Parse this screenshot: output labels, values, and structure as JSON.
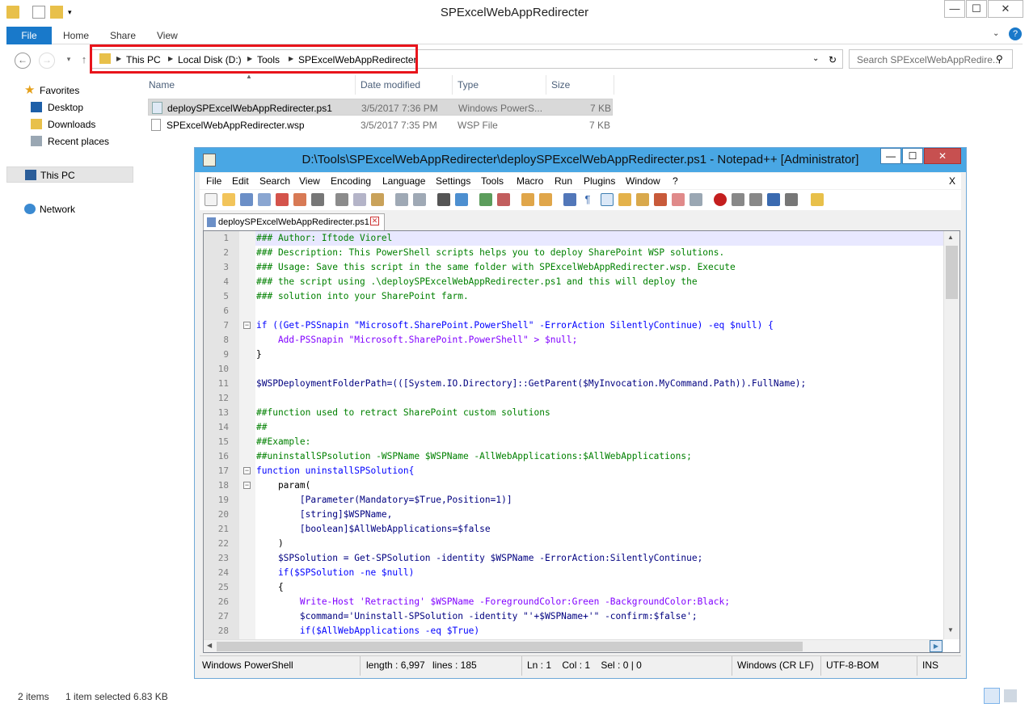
{
  "explorer": {
    "title": "SPExcelWebAppRedirecter",
    "window_controls": {
      "minimize": "—",
      "maximize": "☐",
      "close": "✕"
    },
    "ribbon": {
      "file": "File",
      "tabs": [
        "Home",
        "Share",
        "View"
      ]
    },
    "breadcrumb": [
      "This PC",
      "Local Disk (D:)",
      "Tools",
      "SPExcelWebAppRedirecter"
    ],
    "search_placeholder": "Search SPExcelWebAppRedire...",
    "nav_tree": [
      {
        "label": "Favorites",
        "icon": "star-icon"
      },
      {
        "label": "Desktop",
        "icon": "desktop-icon"
      },
      {
        "label": "Downloads",
        "icon": "downloads-folder-icon"
      },
      {
        "label": "Recent places",
        "icon": "recent-places-icon"
      },
      {
        "label": "This PC",
        "icon": "computer-icon"
      },
      {
        "label": "Network",
        "icon": "network-icon"
      }
    ],
    "columns": [
      "Name",
      "Date modified",
      "Type",
      "Size"
    ],
    "files": [
      {
        "name": "deploySPExcelWebAppRedirecter.ps1",
        "date": "3/5/2017 7:36 PM",
        "type": "Windows PowerS...",
        "size": "7 KB"
      },
      {
        "name": "SPExcelWebAppRedirecter.wsp",
        "date": "3/5/2017 7:35 PM",
        "type": "WSP File",
        "size": "7 KB"
      }
    ],
    "status": {
      "items": "2 items",
      "selected": "1 item selected  6.83 KB"
    }
  },
  "notepad": {
    "title": "D:\\Tools\\SPExcelWebAppRedirecter\\deploySPExcelWebAppRedirecter.ps1 - Notepad++ [Administrator]",
    "menu": [
      "File",
      "Edit",
      "Search",
      "View",
      "Encoding",
      "Language",
      "Settings",
      "Tools",
      "Macro",
      "Run",
      "Plugins",
      "Window",
      "?"
    ],
    "menu_close": "X",
    "tab": "deploySPExcelWebAppRedirecter.ps1",
    "lines": [
      "### Author: Iftode Viorel",
      "### Description: This PowerShell scripts helps you to deploy SharePoint WSP solutions.",
      "### Usage: Save this script in the same folder with SPExcelWebAppRedirecter.wsp. Execute",
      "### the script using .\\deploySPExcelWebAppRedirecter.ps1 and this will deploy the",
      "### solution into your SharePoint farm.",
      "",
      "if ((Get-PSSnapin \"Microsoft.SharePoint.PowerShell\" -ErrorAction SilentlyContinue) -eq $null) {",
      "    Add-PSSnapin \"Microsoft.SharePoint.PowerShell\" > $null;",
      "}",
      "",
      "$WSPDeploymentFolderPath=(([System.IO.Directory]::GetParent($MyInvocation.MyCommand.Path)).FullName);",
      "",
      "##function used to retract SharePoint custom solutions",
      "##",
      "##Example:",
      "##uninstallSPsolution -WSPName $WSPName -AllWebApplications:$AllWebApplications;",
      "function uninstallSPSolution{",
      "    param(",
      "        [Parameter(Mandatory=$True,Position=1)]",
      "        [string]$WSPName,",
      "        [boolean]$AllWebApplications=$false",
      "    )",
      "    $SPSolution = Get-SPSolution -identity $WSPName -ErrorAction:SilentlyContinue;",
      "    if($SPSolution -ne $null)",
      "    {",
      "        Write-Host 'Retracting' $WSPName -ForegroundColor:Green -BackgroundColor:Black;",
      "        $command='Uninstall-SPSolution -identity \"'+$WSPName+'\" -confirm:$false';",
      "        if($AllWebApplications -eq $True)"
    ],
    "status": {
      "lang": "Windows PowerShell",
      "length": "length : 6,997",
      "lines": "lines : 185",
      "pos": "Ln : 1    Col : 1    Sel : 0 | 0",
      "eol": "Windows (CR LF)",
      "enc": "UTF-8-BOM",
      "mode": "INS"
    },
    "colors": {
      "comment": "#008000",
      "keyword": "#0000ff",
      "cmdlet": "#8000ff",
      "variable": "#000080",
      "string": "#808080"
    }
  }
}
